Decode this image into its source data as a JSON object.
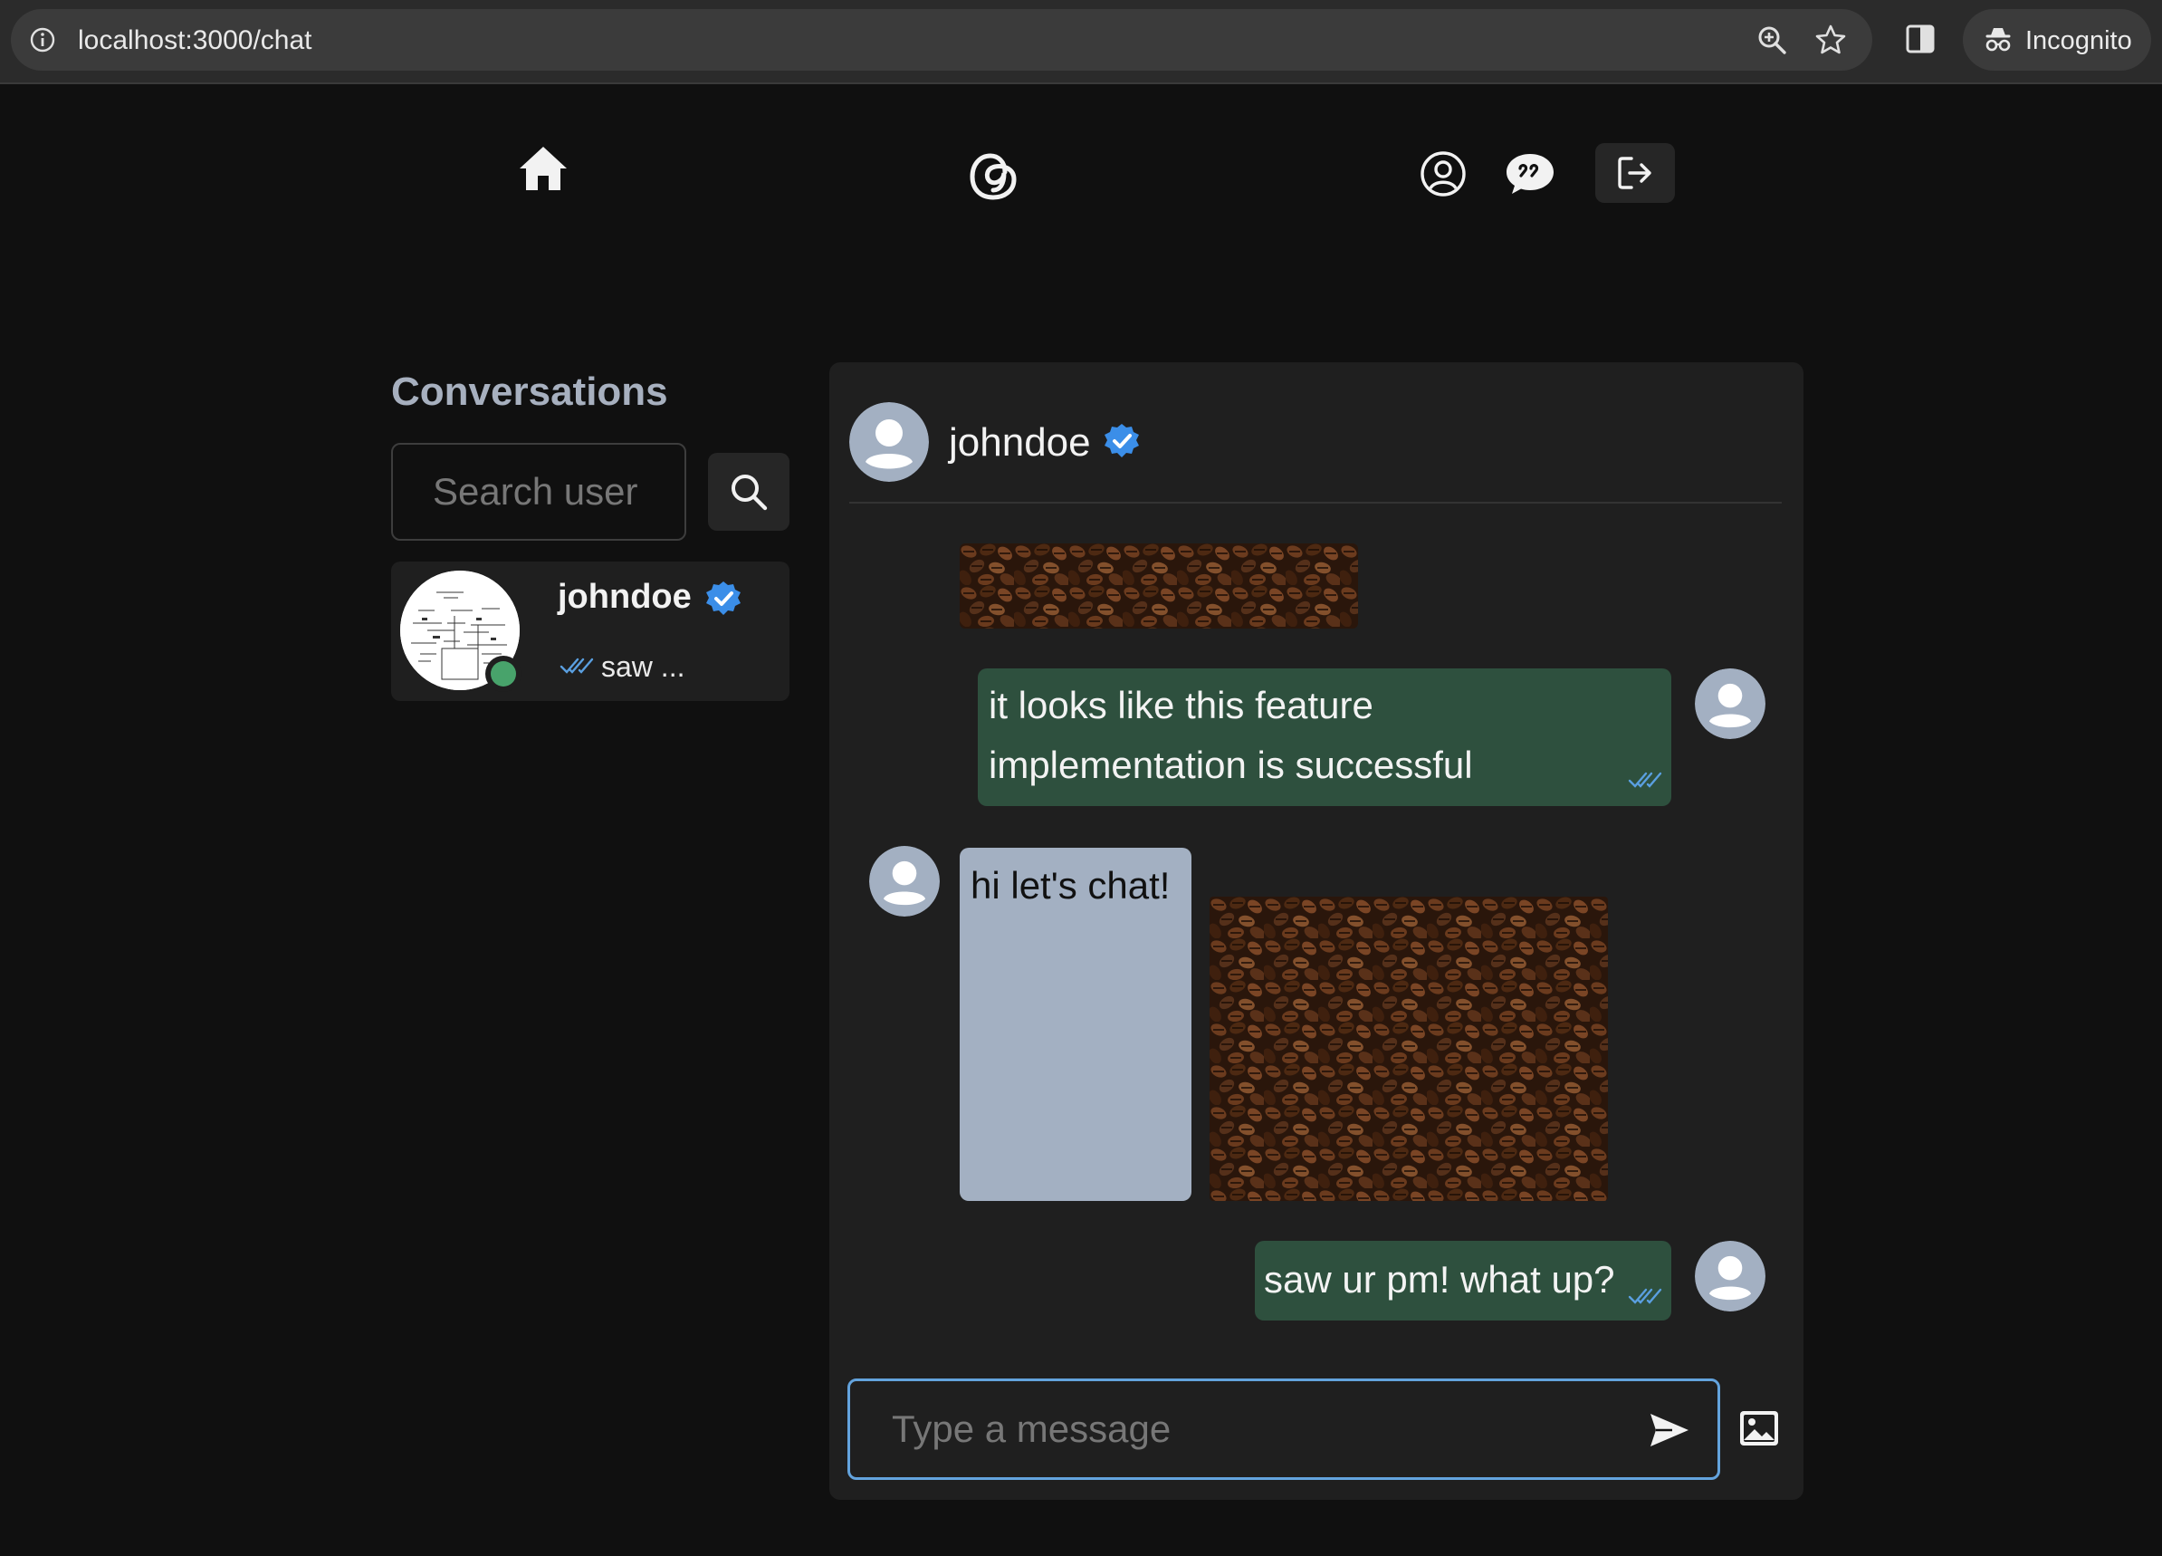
{
  "browser": {
    "url": "localhost:3000/chat",
    "profile_label": "Incognito"
  },
  "sidebar": {
    "title": "Conversations",
    "search_placeholder": "Search user",
    "conversations": [
      {
        "username": "johndoe",
        "verified": true,
        "online": true,
        "last_message": "saw ...",
        "seen": true
      }
    ]
  },
  "chat": {
    "header": {
      "username": "johndoe",
      "verified": true
    },
    "messages": [
      {
        "from": "self",
        "type": "image",
        "image": "coffee-beans"
      },
      {
        "from": "self",
        "type": "text",
        "text_line1": "it looks like this feature",
        "text_line2": "implementation is successful",
        "seen": true
      },
      {
        "from": "other",
        "type": "text",
        "text": "hi let's chat!"
      },
      {
        "from": "other",
        "type": "image",
        "image": "coffee-beans"
      },
      {
        "from": "self",
        "type": "text",
        "text": "saw ur pm! what up?",
        "seen": true
      }
    ],
    "input_placeholder": "Type a message"
  },
  "colors": {
    "background": "#101010",
    "panel": "#1f1f1f",
    "sent_bubble": "#2e503e",
    "received_bubble": "#a3b0c2",
    "verified_badge": "#3b8ee8",
    "online_dot": "#48a36b",
    "input_focus": "#63a3dd",
    "title": "#a7b0bf"
  }
}
